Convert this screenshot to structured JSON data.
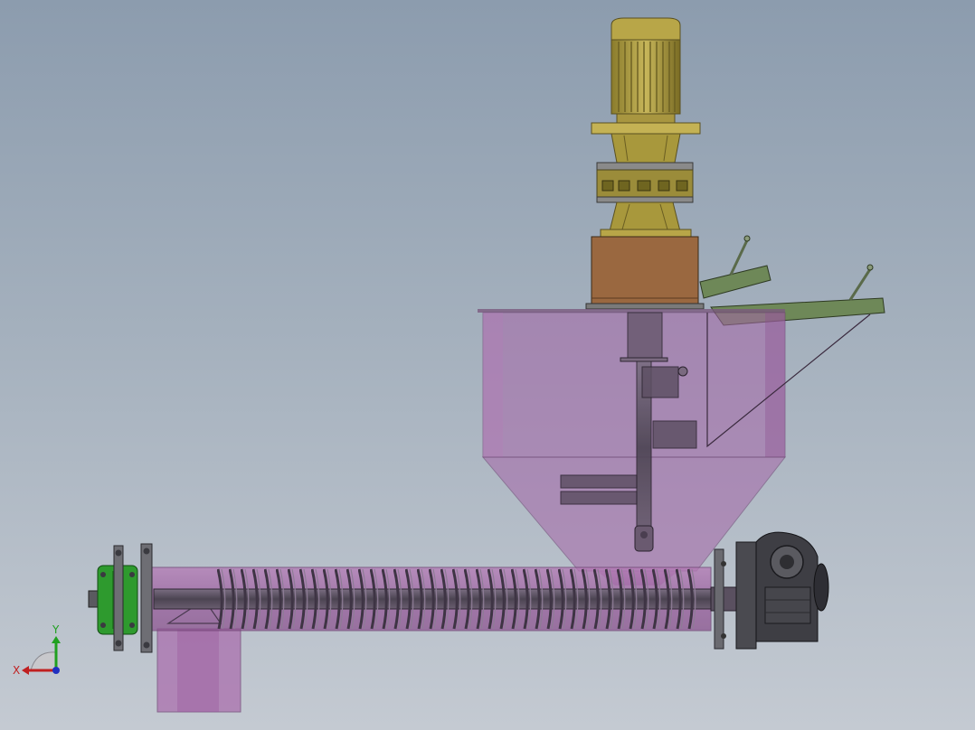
{
  "viewport": {
    "background_top": "#8c9cae",
    "background_bottom": "#c4cad2"
  },
  "model": {
    "components": [
      {
        "id": "drive-motor",
        "icon": "motor-icon",
        "color": "#b8a648"
      },
      {
        "id": "gear-reducer",
        "icon": "gearbox-icon",
        "color": "#9e8f3a"
      },
      {
        "id": "mounting-block",
        "icon": "block-icon",
        "color": "#9a6840"
      },
      {
        "id": "hopper",
        "icon": "hopper-icon",
        "color": "#a566a8"
      },
      {
        "id": "inlet-chutes",
        "icon": "chute-icon",
        "color": "#6e8858"
      },
      {
        "id": "screw-conveyor",
        "icon": "screw-icon",
        "color": "#5a4a60"
      },
      {
        "id": "worm-gearbox",
        "icon": "worm-gear-icon",
        "color": "#4a4a50"
      },
      {
        "id": "end-flange",
        "icon": "flange-icon",
        "color": "#2e9a2e"
      },
      {
        "id": "discharge-chute",
        "icon": "outlet-icon",
        "color": "#a96aac"
      }
    ]
  },
  "triad": {
    "x_label": "X",
    "y_label": "Y",
    "x_color": "#c02020",
    "y_color": "#20a020",
    "z_color": "#2030c0"
  }
}
